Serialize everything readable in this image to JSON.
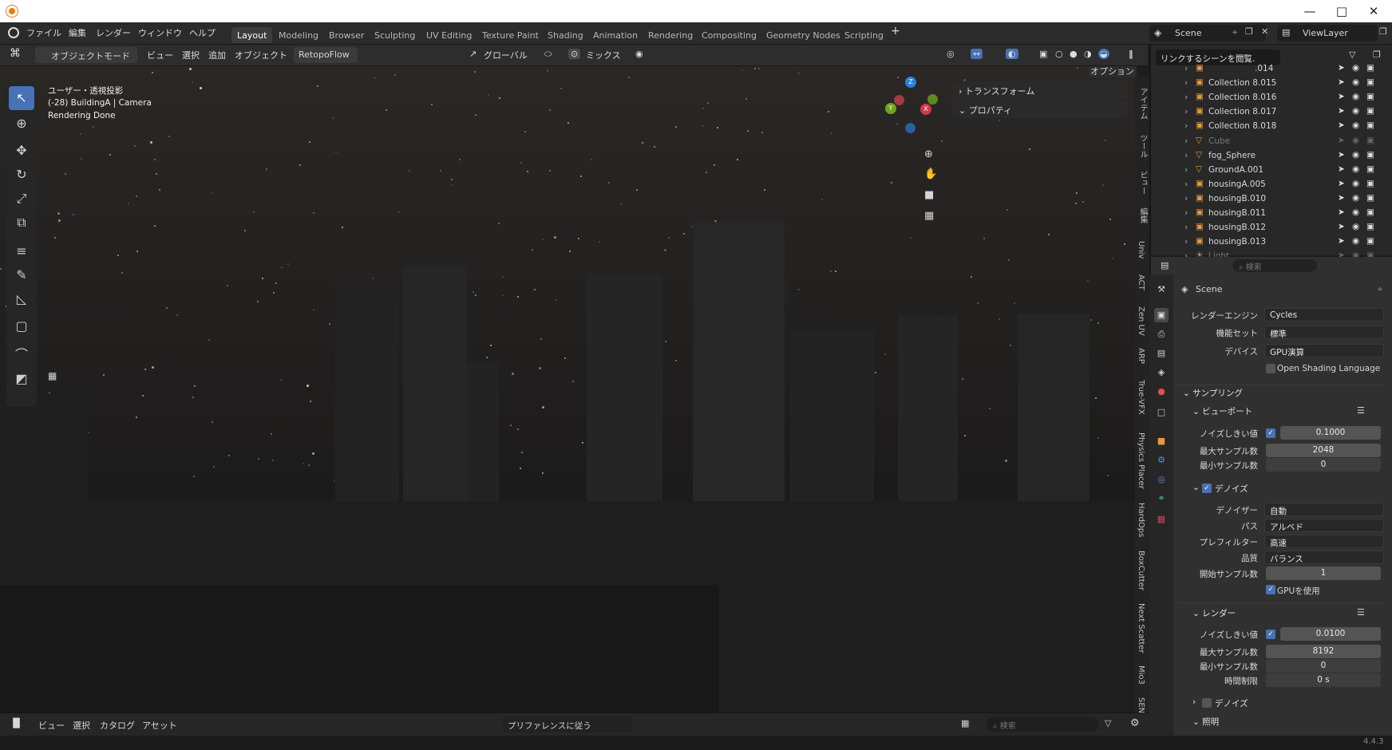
{
  "topbar": {
    "menus": [
      "ファイル",
      "編集",
      "レンダー",
      "ウィンドウ",
      "ヘルプ"
    ],
    "workspaces": [
      "Layout",
      "Modeling",
      "Browser",
      "Sculpting",
      "UV Editing",
      "Texture Paint",
      "Shading",
      "Animation",
      "Rendering",
      "Compositing",
      "Geometry Nodes",
      "Scripting"
    ],
    "active_workspace": "Layout",
    "scene": "Scene",
    "view_layer": "ViewLayer"
  },
  "header": {
    "mode": "オブジェクトモード",
    "menus": [
      "ビュー",
      "選択",
      "追加",
      "オブジェクト"
    ],
    "addon": "RetopoFlow",
    "orientation": "グローバル",
    "snap": "ミックス",
    "options": "オプション"
  },
  "viewport": {
    "line1": "ユーザー・透視投影",
    "line2": "(-28) BuildingA | Camera",
    "line3": "Rendering Done"
  },
  "npanel": {
    "transform": "トランスフォーム",
    "properties": "プロパティ",
    "tabs": [
      "アイテム",
      "ツール",
      "ビュー",
      "編集",
      "Univ",
      "ACT",
      "Zen UV",
      "ARP",
      "True-VFX",
      "Physics Placer",
      "HardOps",
      "BoxCutter",
      "Next Scatter",
      "Mio3",
      "SEN"
    ]
  },
  "outliner": {
    "tooltip": "リンクするシーンを閲覧.",
    "items": [
      {
        "name": ".014"
      },
      {
        "name": "Collection 8.015"
      },
      {
        "name": "Collection 8.016"
      },
      {
        "name": "Collection 8.017"
      },
      {
        "name": "Collection 8.018"
      },
      {
        "name": "Cube"
      },
      {
        "name": "fog_Sphere"
      },
      {
        "name": "GroundA.001"
      },
      {
        "name": "housingA.005"
      },
      {
        "name": "housingB.010"
      },
      {
        "name": "housingB.011"
      },
      {
        "name": "housingB.012"
      },
      {
        "name": "housingB.013"
      },
      {
        "name": "Light"
      }
    ]
  },
  "properties": {
    "search_placeholder": "検索",
    "scene": "Scene",
    "render_engine_label": "レンダーエンジン",
    "render_engine": "Cycles",
    "feature_set_label": "機能セット",
    "feature_set": "標準",
    "device_label": "デバイス",
    "device": "GPU演算",
    "osl": "Open Shading Language",
    "sampling": "サンプリング",
    "viewport": "ビューポート",
    "noise_label": "ノイズしきい値",
    "vp_noise": "0.1000",
    "max_samples_label": "最大サンプル数",
    "vp_max": "2048",
    "min_samples_label": "最小サンプル数",
    "vp_min": "0",
    "denoise": "デノイズ",
    "denoiser_label": "デノイザー",
    "denoiser": "自動",
    "pass_label": "パス",
    "pass": "アルベド",
    "prefilter_label": "プレフィルター",
    "prefilter": "高速",
    "quality_label": "品質",
    "quality": "バランス",
    "start_sample_label": "開始サンプル数",
    "start_sample": "1",
    "use_gpu": "GPUを使用",
    "render": "レンダー",
    "r_noise": "0.0100",
    "r_max": "8192",
    "r_min": "0",
    "time_limit_label": "時間制限",
    "time_limit": "0 s",
    "denoise2": "デノイズ",
    "lighting": "照明"
  },
  "statusbar": {
    "menus": [
      "ビュー",
      "選択",
      "カタログ",
      "アセット"
    ],
    "dropdown": "プリファレンスに従う",
    "search_placeholder": "検索"
  },
  "version": "4.4.3"
}
